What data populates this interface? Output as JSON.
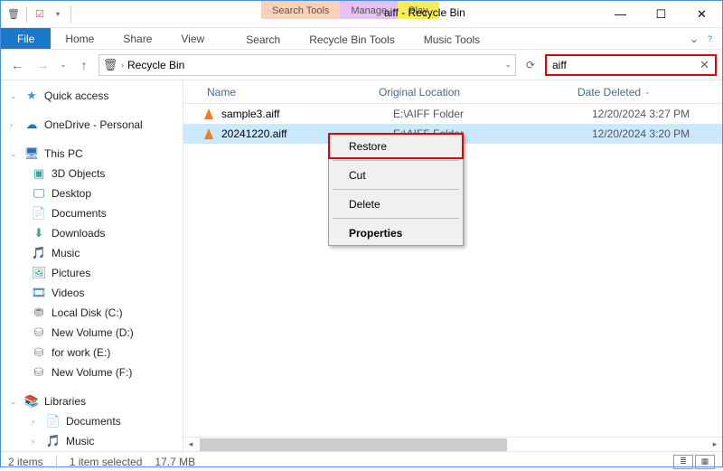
{
  "titlebar": {
    "context_tabs": {
      "search": "Search Tools",
      "manage": "Manage",
      "play": "Play"
    },
    "window_title": "aiff - Recycle Bin"
  },
  "ribbon": {
    "file": "File",
    "tabs": [
      "Home",
      "Share",
      "View"
    ],
    "context": [
      "Search",
      "Recycle Bin Tools",
      "Music Tools"
    ]
  },
  "address": {
    "location": "Recycle Bin",
    "search_value": "aiff"
  },
  "sidebar": {
    "quick_access": "Quick access",
    "onedrive": "OneDrive - Personal",
    "this_pc": "This PC",
    "pc_items": [
      "3D Objects",
      "Desktop",
      "Documents",
      "Downloads",
      "Music",
      "Pictures",
      "Videos",
      "Local Disk (C:)",
      "New Volume (D:)",
      "for work (E:)",
      "New Volume (F:)"
    ],
    "libraries": "Libraries",
    "lib_items": [
      "Documents",
      "Music"
    ]
  },
  "columns": {
    "name": "Name",
    "location": "Original Location",
    "date": "Date Deleted"
  },
  "files": [
    {
      "name": "sample3.aiff",
      "location": "E:\\AIFF Folder",
      "date": "12/20/2024 3:27 PM",
      "selected": false
    },
    {
      "name": "20241220.aiff",
      "location": "E:\\AIFF Folder",
      "date": "12/20/2024 3:20 PM",
      "selected": true
    }
  ],
  "context_menu": {
    "restore": "Restore",
    "cut": "Cut",
    "delete": "Delete",
    "properties": "Properties"
  },
  "status": {
    "count": "2 items",
    "selected": "1 item selected",
    "size": "17.7 MB"
  }
}
